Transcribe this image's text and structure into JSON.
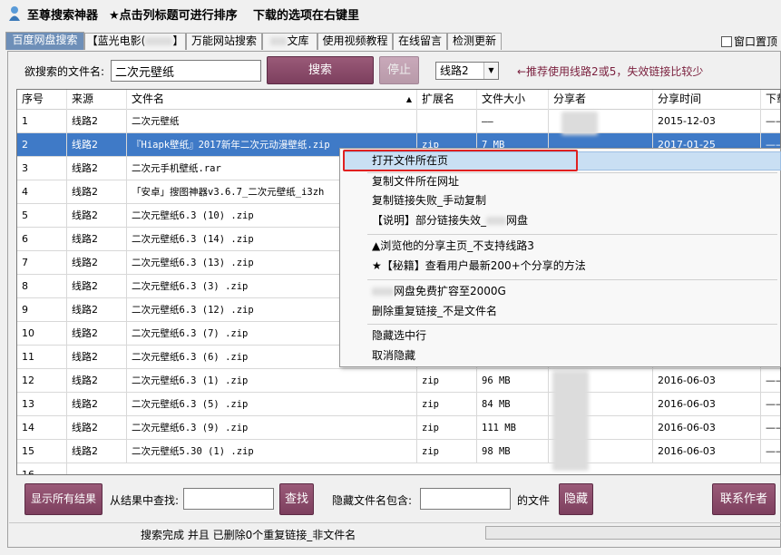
{
  "app": {
    "title": "至尊搜索神器",
    "tip1": "★点击列标题可进行排序",
    "tip2": "下载的选项在右键里"
  },
  "tabs": [
    {
      "label": "百度网盘搜索",
      "active": true
    },
    {
      "label": "【蓝光电影(",
      "active": false
    },
    {
      "label": "万能网站搜索",
      "active": false
    },
    {
      "label": "文库",
      "active": false
    },
    {
      "label": "使用视频教程",
      "active": false
    },
    {
      "label": "在线留言",
      "active": false
    },
    {
      "label": "检测更新",
      "active": false
    }
  ],
  "pin_window": {
    "label": "窗口置顶",
    "checked": false
  },
  "search": {
    "label": "欲搜索的文件名:",
    "value": "二次元壁纸",
    "search_button": "搜索",
    "stop_button": "停止",
    "route_selected": "线路2",
    "hint": "←推荐使用线路2或5，失效链接比较少"
  },
  "table": {
    "columns": [
      "序号",
      "来源",
      "文件名",
      "扩展名",
      "文件大小",
      "分享者",
      "分享时间",
      "下载"
    ],
    "rows": [
      {
        "no": "1",
        "source": "线路2",
        "name": "二次元壁纸",
        "ext": "",
        "size": "——",
        "sharer": "",
        "time": "2015-12-03",
        "dl": "——"
      },
      {
        "no": "2",
        "source": "线路2",
        "name": "『Hiapk壁纸』2017新年二次元动漫壁纸.zip",
        "ext": "zip",
        "size": "7 MB",
        "sharer": "",
        "time": "2017-01-25",
        "dl": "——"
      },
      {
        "no": "3",
        "source": "线路2",
        "name": "二次元手机壁纸.rar",
        "ext": "",
        "size": "",
        "sharer": "",
        "time": "",
        "dl": ""
      },
      {
        "no": "4",
        "source": "线路2",
        "name": "「安卓」搜图神器v3.6.7_二次元壁纸_i3zh",
        "ext": "",
        "size": "",
        "sharer": "",
        "time": "",
        "dl": ""
      },
      {
        "no": "5",
        "source": "线路2",
        "name": "二次元壁纸6.3 (10) .zip",
        "ext": "",
        "size": "",
        "sharer": "",
        "time": "",
        "dl": ""
      },
      {
        "no": "6",
        "source": "线路2",
        "name": "二次元壁纸6.3 (14) .zip",
        "ext": "",
        "size": "",
        "sharer": "",
        "time": "",
        "dl": ""
      },
      {
        "no": "7",
        "source": "线路2",
        "name": "二次元壁纸6.3 (13) .zip",
        "ext": "",
        "size": "",
        "sharer": "",
        "time": "",
        "dl": ""
      },
      {
        "no": "8",
        "source": "线路2",
        "name": "二次元壁纸6.3 (3) .zip",
        "ext": "",
        "size": "",
        "sharer": "",
        "time": "",
        "dl": ""
      },
      {
        "no": "9",
        "source": "线路2",
        "name": "二次元壁纸6.3 (12) .zip",
        "ext": "",
        "size": "",
        "sharer": "",
        "time": "",
        "dl": ""
      },
      {
        "no": "10",
        "source": "线路2",
        "name": "二次元壁纸6.3 (7) .zip",
        "ext": "",
        "size": "",
        "sharer": "",
        "time": "",
        "dl": ""
      },
      {
        "no": "11",
        "source": "线路2",
        "name": "二次元壁纸6.3 (6) .zip",
        "ext": "",
        "size": "",
        "sharer": "",
        "time": "",
        "dl": ""
      },
      {
        "no": "12",
        "source": "线路2",
        "name": "二次元壁纸6.3 (1) .zip",
        "ext": "zip",
        "size": "96 MB",
        "sharer": "",
        "time": "2016-06-03",
        "dl": "——"
      },
      {
        "no": "13",
        "source": "线路2",
        "name": "二次元壁纸6.3 (5) .zip",
        "ext": "zip",
        "size": "84 MB",
        "sharer": "",
        "time": "2016-06-03",
        "dl": "——"
      },
      {
        "no": "14",
        "source": "线路2",
        "name": "二次元壁纸6.3 (9) .zip",
        "ext": "zip",
        "size": "111 MB",
        "sharer": "",
        "time": "2016-06-03",
        "dl": "——"
      },
      {
        "no": "15",
        "source": "线路2",
        "name": "二次元壁纸5.30 (1) .zip",
        "ext": "zip",
        "size": "98 MB",
        "sharer": "",
        "time": "2016-06-03",
        "dl": "——"
      }
    ]
  },
  "context_menu": {
    "items": [
      "打开文件所在页",
      "复制文件所在网址",
      "复制链接失败_手动复制",
      "【说明】部分链接失效_",
      "网盘",
      "▲浏览他的分享主页_不支持线路3",
      "★【秘籍】查看用户最新200+个分享的方法",
      "网盘免费扩容至2000G",
      "删除重复链接_不是文件名",
      "隐藏选中行",
      "取消隐藏"
    ]
  },
  "bottom": {
    "show_all": "显示所有结果",
    "find_label": "从结果中查找:",
    "find_value": "",
    "find_button": "查找",
    "hide_label": "隐藏文件名包含:",
    "hide_value": "",
    "file_suffix": "的文件",
    "hide_button": "隐藏",
    "contact_button": "联系作者",
    "status": "搜索完成 并且 已删除0个重复链接_非文件名"
  },
  "colors": {
    "accent_maroon": "#7d3f5e",
    "selected_row": "#3f7ac7",
    "highlight_box": "#e02020",
    "hint_text": "#7a1f3d"
  }
}
